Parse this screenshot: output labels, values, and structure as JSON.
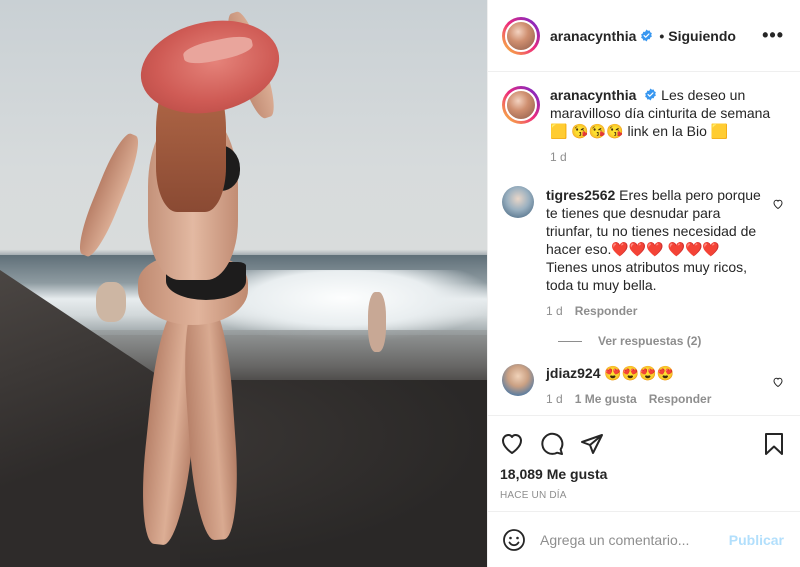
{
  "header": {
    "username": "aranacynthia",
    "separator": "•",
    "follow_status": "Siguiendo",
    "more_label": "•••"
  },
  "caption": {
    "username": "aranacynthia",
    "text": "Les deseo un maravilloso día cinturita de semana 🟨 😘😘😘 link en la Bio 🟨",
    "time": "1 d"
  },
  "comments": [
    {
      "username": "tigres2562",
      "text": "Eres bella pero porque te tienes que desnudar para triunfar, tu no tienes necesidad de hacer eso.❤️❤️❤️ ❤️❤️❤️ Tienes unos atributos muy ricos, toda tu muy bella.",
      "time": "1 d",
      "reply_label": "Responder",
      "view_replies": "Ver respuestas (2)"
    },
    {
      "username": "jdiaz924",
      "text": "😍😍😍😍",
      "time": "1 d",
      "likes_label": "1 Me gusta",
      "reply_label": "Responder"
    }
  ],
  "actions": {
    "likes": "18,089 Me gusta",
    "time_ago": "HACE UN DÍA"
  },
  "add_comment": {
    "placeholder": "Agrega un comentario...",
    "publish_label": "Publicar"
  },
  "colors": {
    "verified": "#3897f0",
    "publish_disabled": "#b2dffc",
    "meta_text": "#8e8e8e"
  }
}
